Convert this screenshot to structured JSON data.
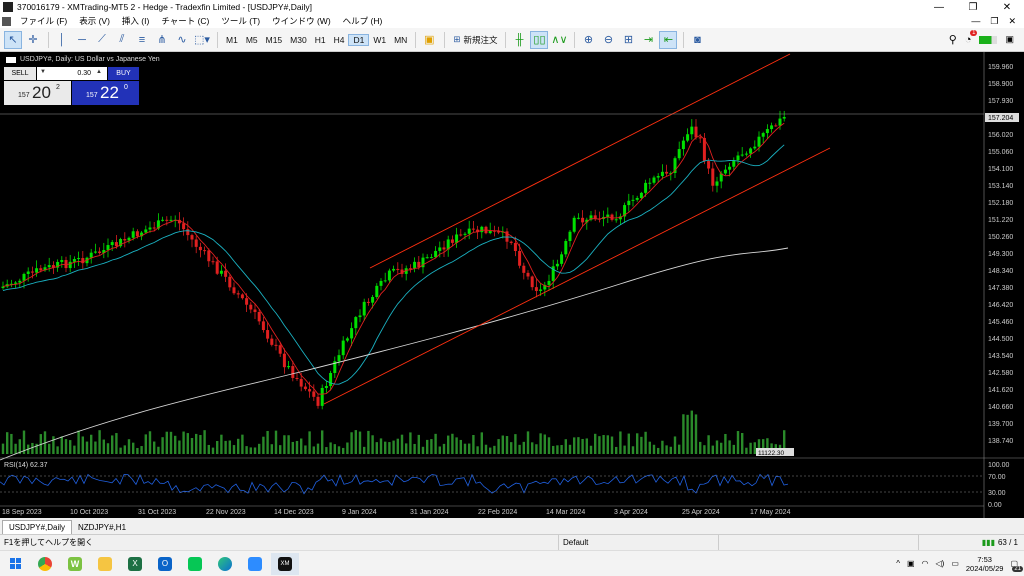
{
  "window": {
    "title": "370016179 - XMTrading-MT5 2 - Hedge - Tradexfin Limited - [USDJPY#,Daily]",
    "controls": [
      "—",
      "❐",
      "✕"
    ]
  },
  "menu": {
    "items": [
      "ファイル (F)",
      "表示 (V)",
      "挿入 (I)",
      "チャート (C)",
      "ツール (T)",
      "ウインドウ (W)",
      "ヘルプ (H)"
    ],
    "right_glyphs": [
      "—",
      "❐",
      "✕"
    ]
  },
  "toolbar": {
    "timeframes": [
      "M1",
      "M5",
      "M15",
      "M30",
      "H1",
      "H4",
      "D1",
      "W1",
      "MN"
    ],
    "active_timeframe": "D1",
    "new_order_label": "新規注文",
    "notification_count": "1"
  },
  "chart": {
    "symbol_line": "USDJPY#, Daily:  US Dollar vs Japanese Yen",
    "trade_panel": {
      "sell_label": "SELL",
      "buy_label": "BUY",
      "lot": "0.30",
      "sell_big": "157",
      "sell_main": "20",
      "sell_sup": "2",
      "buy_big": "157",
      "buy_main": "22",
      "buy_sup": "0"
    },
    "price_axis": [
      "159.960",
      "158.900",
      "157.930",
      "157.204",
      "156.020",
      "155.060",
      "154.100",
      "153.140",
      "152.180",
      "151.220",
      "150.260",
      "149.300",
      "148.340",
      "147.380",
      "146.420",
      "145.460",
      "144.500",
      "143.540",
      "142.580",
      "141.620",
      "140.660",
      "139.700",
      "138.740"
    ],
    "volume_label": "11122.30",
    "rsi_label": "RSI(14) 62.37",
    "rsi_axis": [
      "100.00",
      "70.00",
      "30.00",
      "0.00"
    ],
    "date_axis": [
      "18 Sep 2023",
      "10 Oct 2023",
      "31 Oct 2023",
      "22 Nov 2023",
      "14 Dec 2023",
      "9 Jan 2024",
      "31 Jan 2024",
      "22 Feb 2024",
      "14 Mar 2024",
      "3 Apr 2024",
      "25 Apr 2024",
      "17 May 2024"
    ],
    "colors": {
      "bull": "#00e000",
      "bear": "#e02020",
      "ma_fast": "#1ab0c0",
      "ma_slow": "#d8d8d8",
      "channel": "#ff3010",
      "rsi": "#2060e0"
    }
  },
  "tabs": [
    "USDJPY#,Daily",
    "NZDJPY#,H1"
  ],
  "status": {
    "help": "F1を押してヘルプを開く",
    "profile": "Default",
    "signal": "63 / 1"
  },
  "taskbar": {
    "time": "7:53",
    "date": "2024/05/29",
    "notif": "21",
    "apps": [
      "Chrome",
      "W",
      "Explorer",
      "Excel",
      "Outlook",
      "LINE",
      "Edge",
      "Zoom",
      "XM"
    ]
  }
}
